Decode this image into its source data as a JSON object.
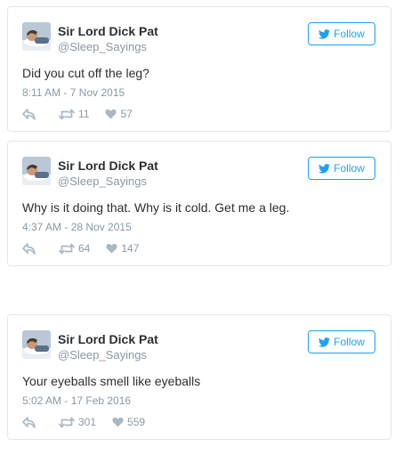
{
  "tweets": [
    {
      "name": "Sir Lord Dick Pat",
      "handle": "@Sleep_Sayings",
      "follow_label": "Follow",
      "text": "Did you cut off the leg?",
      "timestamp": "8:11 AM - 7 Nov 2015",
      "retweets": "11",
      "likes": "57"
    },
    {
      "name": "Sir Lord Dick Pat",
      "handle": "@Sleep_Sayings",
      "follow_label": "Follow",
      "text": "Why is it doing that. Why is it cold. Get me a leg.",
      "timestamp": "4:37 AM - 28 Nov 2015",
      "retweets": "64",
      "likes": "147"
    },
    {
      "name": "Sir Lord Dick Pat",
      "handle": "@Sleep_Sayings",
      "follow_label": "Follow",
      "text": "Your eyeballs smell like eyeballs",
      "timestamp": "5:02 AM - 17 Feb 2016",
      "retweets": "301",
      "likes": "559"
    }
  ],
  "colors": {
    "accent": "#1da1f2",
    "muted": "#8899a6",
    "text": "#292f33",
    "border": "#e1e8ed"
  },
  "icons": {
    "follow": "twitter-bird-icon",
    "reply": "reply-icon",
    "retweet": "retweet-icon",
    "like": "heart-icon"
  }
}
